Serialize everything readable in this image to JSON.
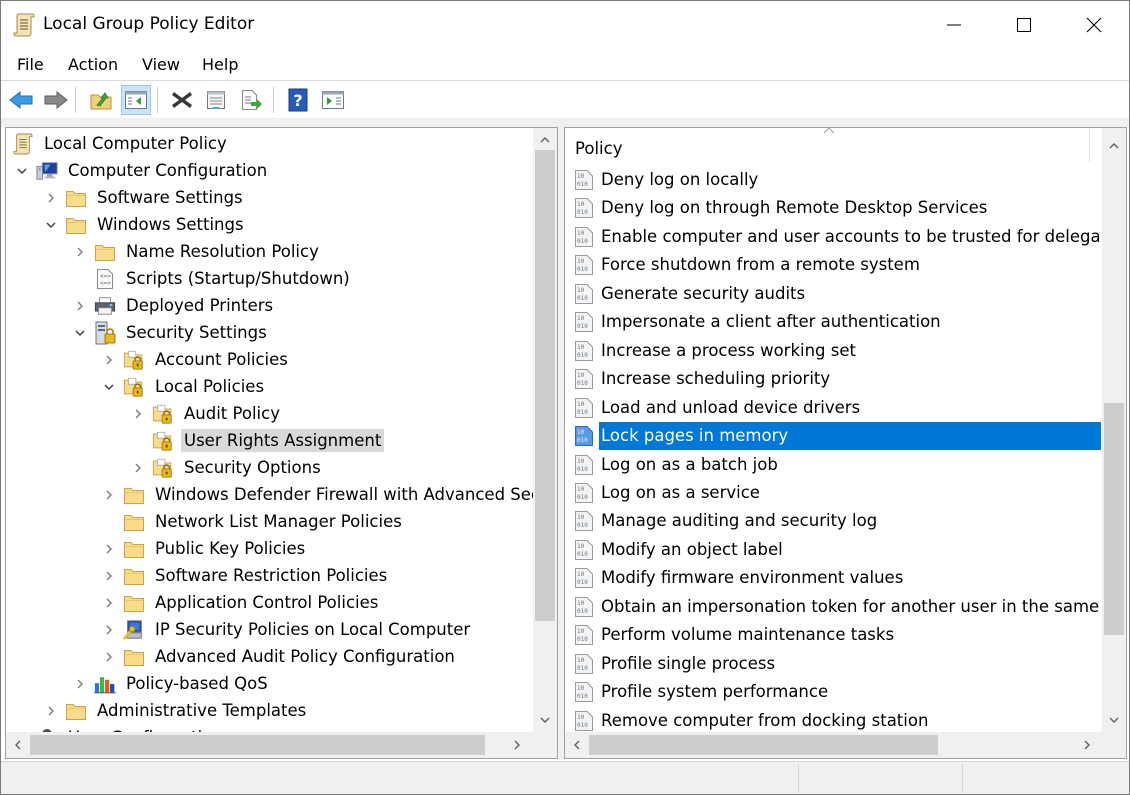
{
  "window": {
    "title": "Local Group Policy Editor",
    "controls": {
      "minimize": "minimize",
      "maximize": "maximize",
      "close": "close"
    }
  },
  "menu": [
    "File",
    "Action",
    "View",
    "Help"
  ],
  "toolbar": [
    {
      "name": "back-button",
      "icon": "back-arrow-icon"
    },
    {
      "name": "forward-button",
      "icon": "forward-arrow-icon"
    },
    {
      "name": "up-one-level-button",
      "icon": "folder-up-icon"
    },
    {
      "name": "show-hide-console-tree-button",
      "icon": "console-tree-icon",
      "active": true
    },
    {
      "name": "delete-button",
      "icon": "delete-x-icon"
    },
    {
      "name": "properties-button",
      "icon": "properties-icon"
    },
    {
      "name": "export-list-button",
      "icon": "export-list-icon"
    },
    {
      "name": "help-button",
      "icon": "help-icon"
    },
    {
      "name": "show-hide-action-pane-button",
      "icon": "action-pane-icon"
    }
  ],
  "tree": {
    "items": [
      {
        "label": "Local Computer Policy",
        "level": 0,
        "chevron": "none",
        "icon": "scroll"
      },
      {
        "label": "Computer Configuration",
        "level": 1,
        "chevron": "down",
        "icon": "computer"
      },
      {
        "label": "Software Settings",
        "level": 2,
        "chevron": "right",
        "icon": "folder"
      },
      {
        "label": "Windows Settings",
        "level": 2,
        "chevron": "down",
        "icon": "folder"
      },
      {
        "label": "Name Resolution Policy",
        "level": 3,
        "chevron": "right",
        "icon": "folder"
      },
      {
        "label": "Scripts (Startup/Shutdown)",
        "level": 3,
        "chevron": "none",
        "icon": "script"
      },
      {
        "label": "Deployed Printers",
        "level": 3,
        "chevron": "right",
        "icon": "printer"
      },
      {
        "label": "Security Settings",
        "level": 3,
        "chevron": "down",
        "icon": "security"
      },
      {
        "label": "Account Policies",
        "level": 4,
        "chevron": "right",
        "icon": "lockfolder"
      },
      {
        "label": "Local Policies",
        "level": 4,
        "chevron": "down",
        "icon": "lockfolder"
      },
      {
        "label": "Audit Policy",
        "level": 5,
        "chevron": "right",
        "icon": "lockfolder"
      },
      {
        "label": "User Rights Assignment",
        "level": 5,
        "chevron": "none",
        "icon": "lockfolder",
        "selected": true
      },
      {
        "label": "Security Options",
        "level": 5,
        "chevron": "right",
        "icon": "lockfolder"
      },
      {
        "label": "Windows Defender Firewall with Advanced Security",
        "level": 4,
        "chevron": "right",
        "icon": "folder"
      },
      {
        "label": "Network List Manager Policies",
        "level": 4,
        "chevron": "none",
        "icon": "folder"
      },
      {
        "label": "Public Key Policies",
        "level": 4,
        "chevron": "right",
        "icon": "folder"
      },
      {
        "label": "Software Restriction Policies",
        "level": 4,
        "chevron": "right",
        "icon": "folder"
      },
      {
        "label": "Application Control Policies",
        "level": 4,
        "chevron": "right",
        "icon": "folder"
      },
      {
        "label": "IP Security Policies on Local Computer",
        "level": 4,
        "chevron": "right",
        "icon": "ipsec"
      },
      {
        "label": "Advanced Audit Policy Configuration",
        "level": 4,
        "chevron": "right",
        "icon": "folder"
      },
      {
        "label": "Policy-based QoS",
        "level": 3,
        "chevron": "right",
        "icon": "qos"
      },
      {
        "label": "Administrative Templates",
        "level": 2,
        "chevron": "right",
        "icon": "folder"
      },
      {
        "label": "User Configuration",
        "level": 1,
        "chevron": "none",
        "icon": "user"
      }
    ]
  },
  "list": {
    "column_header": "Policy",
    "sort_indicator": "ascending",
    "items": [
      {
        "label": "Deny log on locally"
      },
      {
        "label": "Deny log on through Remote Desktop Services"
      },
      {
        "label": "Enable computer and user accounts to be trusted for delegati..."
      },
      {
        "label": "Force shutdown from a remote system"
      },
      {
        "label": "Generate security audits"
      },
      {
        "label": "Impersonate a client after authentication"
      },
      {
        "label": "Increase a process working set"
      },
      {
        "label": "Increase scheduling priority"
      },
      {
        "label": "Load and unload device drivers"
      },
      {
        "label": "Lock pages in memory",
        "selected": true
      },
      {
        "label": "Log on as a batch job"
      },
      {
        "label": "Log on as a service"
      },
      {
        "label": "Manage auditing and security log"
      },
      {
        "label": "Modify an object label"
      },
      {
        "label": "Modify firmware environment values"
      },
      {
        "label": "Obtain an impersonation token for another user in the same ..."
      },
      {
        "label": "Perform volume maintenance tasks"
      },
      {
        "label": "Profile single process"
      },
      {
        "label": "Profile system performance"
      },
      {
        "label": "Remove computer from docking station"
      }
    ]
  },
  "colors": {
    "selection": "#0078d7",
    "tree_selection": "#d9d9d9",
    "scroll_thumb": "#cdcdcd",
    "scroll_track": "#f0f0f0"
  }
}
